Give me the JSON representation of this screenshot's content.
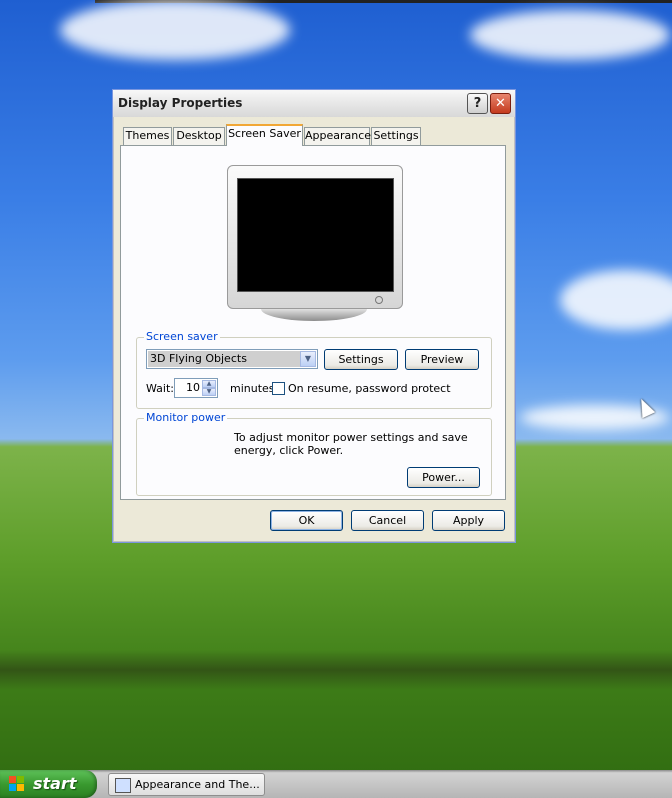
{
  "window": {
    "title": "Display Properties",
    "help_label": "?",
    "close_label": "✕"
  },
  "tabs": [
    {
      "label": "Themes",
      "active": false
    },
    {
      "label": "Desktop",
      "active": false
    },
    {
      "label": "Screen Saver",
      "active": true
    },
    {
      "label": "Appearance",
      "active": false
    },
    {
      "label": "Settings",
      "active": false
    }
  ],
  "screen_saver": {
    "group_label": "Screen saver",
    "selected": "3D Flying Objects",
    "settings_button": "Settings",
    "preview_button": "Preview",
    "wait_label": "Wait:",
    "wait_value": "10",
    "minutes_label": "minutes",
    "password_label": "On resume, password protect",
    "password_checked": false
  },
  "monitor_power": {
    "group_label": "Monitor power",
    "description": "To adjust monitor power settings and save energy, click Power.",
    "power_button": "Power..."
  },
  "footer": {
    "ok": "OK",
    "cancel": "Cancel",
    "apply": "Apply"
  },
  "taskbar": {
    "start_label": "start",
    "task_item": "Appearance and The..."
  },
  "colors": {
    "group_label": "#0046d5",
    "active_tab_accent": "#f1a735",
    "close_button": "#c43a1e",
    "start_button": "#3a9a30"
  },
  "icons": [
    "help-icon",
    "close-icon",
    "chevron-down-icon",
    "spin-up-icon",
    "spin-down-icon",
    "windows-flag-icon",
    "control-panel-icon",
    "mouse-cursor-icon"
  ]
}
